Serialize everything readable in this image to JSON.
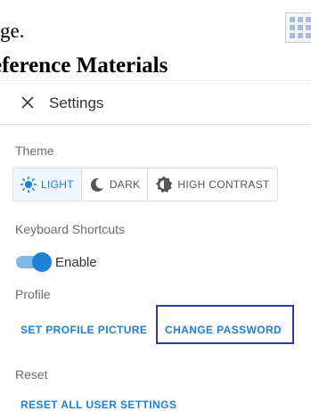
{
  "background": {
    "line1": "ge.",
    "line2": "eference Materials"
  },
  "settings": {
    "title": "Settings",
    "theme": {
      "label": "Theme",
      "options": [
        {
          "label": "LIGHT",
          "icon": "sun-icon",
          "selected": true
        },
        {
          "label": "DARK",
          "icon": "moon-icon",
          "selected": false
        },
        {
          "label": "HIGH CONTRAST",
          "icon": "contrast-icon",
          "selected": false
        }
      ]
    },
    "keyboard": {
      "label": "Keyboard Shortcuts",
      "toggle_label": "Enable",
      "enabled": true
    },
    "profile": {
      "label": "Profile",
      "set_picture": "SET PROFILE PICTURE",
      "change_password": "CHANGE PASSWORD"
    },
    "reset": {
      "label": "Reset",
      "reset_all": "RESET ALL USER SETTINGS"
    }
  },
  "colors": {
    "accent": "#1e7fd4",
    "focus_outline": "#2f3e9e"
  }
}
